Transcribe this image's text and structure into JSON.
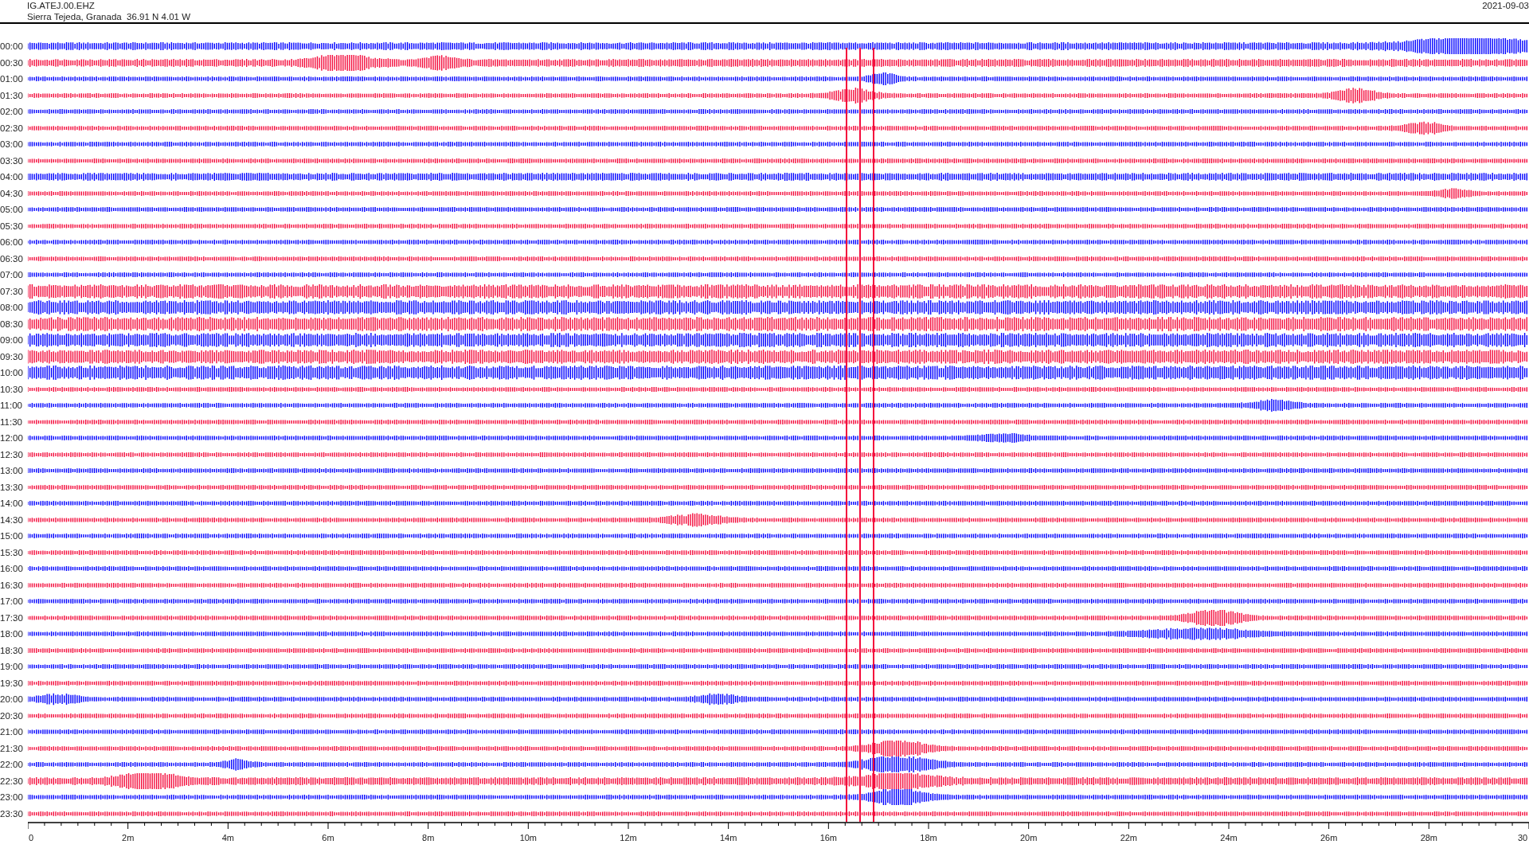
{
  "header": {
    "station": "IG.ATEJ.00.EHZ",
    "location": "Sierra Tejeda, Granada  36.91 N 4.01 W",
    "date": "2021-09-03"
  },
  "rows": [
    {
      "time": "00:00",
      "color": "#0000ff"
    },
    {
      "time": "00:30",
      "color": "#f40c3c"
    },
    {
      "time": "01:00",
      "color": "#0000ff"
    },
    {
      "time": "01:30",
      "color": "#f40c3c"
    },
    {
      "time": "02:00",
      "color": "#0000ff"
    },
    {
      "time": "02:30",
      "color": "#f40c3c"
    },
    {
      "time": "03:00",
      "color": "#0000ff"
    },
    {
      "time": "03:30",
      "color": "#f40c3c"
    },
    {
      "time": "04:00",
      "color": "#0000ff"
    },
    {
      "time": "04:30",
      "color": "#f40c3c"
    },
    {
      "time": "05:00",
      "color": "#0000ff"
    },
    {
      "time": "05:30",
      "color": "#f40c3c"
    },
    {
      "time": "06:00",
      "color": "#0000ff"
    },
    {
      "time": "06:30",
      "color": "#f40c3c"
    },
    {
      "time": "07:00",
      "color": "#0000ff"
    },
    {
      "time": "07:30",
      "color": "#f40c3c"
    },
    {
      "time": "08:00",
      "color": "#0000ff"
    },
    {
      "time": "08:30",
      "color": "#f40c3c"
    },
    {
      "time": "09:00",
      "color": "#0000ff"
    },
    {
      "time": "09:30",
      "color": "#f40c3c"
    },
    {
      "time": "10:00",
      "color": "#0000ff"
    },
    {
      "time": "10:30",
      "color": "#f40c3c"
    },
    {
      "time": "11:00",
      "color": "#0000ff"
    },
    {
      "time": "11:30",
      "color": "#f40c3c"
    },
    {
      "time": "12:00",
      "color": "#0000ff"
    },
    {
      "time": "12:30",
      "color": "#f40c3c"
    },
    {
      "time": "13:00",
      "color": "#0000ff"
    },
    {
      "time": "13:30",
      "color": "#f40c3c"
    },
    {
      "time": "14:00",
      "color": "#0000ff"
    },
    {
      "time": "14:30",
      "color": "#f40c3c"
    },
    {
      "time": "15:00",
      "color": "#0000ff"
    },
    {
      "time": "15:30",
      "color": "#f40c3c"
    },
    {
      "time": "16:00",
      "color": "#0000ff"
    },
    {
      "time": "16:30",
      "color": "#f40c3c"
    },
    {
      "time": "17:00",
      "color": "#0000ff"
    },
    {
      "time": "17:30",
      "color": "#f40c3c"
    },
    {
      "time": "18:00",
      "color": "#0000ff"
    },
    {
      "time": "18:30",
      "color": "#f40c3c"
    },
    {
      "time": "19:00",
      "color": "#0000ff"
    },
    {
      "time": "19:30",
      "color": "#f40c3c"
    },
    {
      "time": "20:00",
      "color": "#0000ff"
    },
    {
      "time": "20:30",
      "color": "#f40c3c"
    },
    {
      "time": "21:00",
      "color": "#0000ff"
    },
    {
      "time": "21:30",
      "color": "#f40c3c"
    },
    {
      "time": "22:00",
      "color": "#0000ff"
    },
    {
      "time": "22:30",
      "color": "#f40c3c"
    },
    {
      "time": "23:00",
      "color": "#0000ff"
    },
    {
      "time": "23:30",
      "color": "#f40c3c"
    }
  ],
  "x_axis": {
    "ticks": [
      "0",
      "2m",
      "4m",
      "6m",
      "8m",
      "10m",
      "12m",
      "14m",
      "16m",
      "18m",
      "20m",
      "22m",
      "24m",
      "26m",
      "28m",
      "30"
    ]
  }
}
